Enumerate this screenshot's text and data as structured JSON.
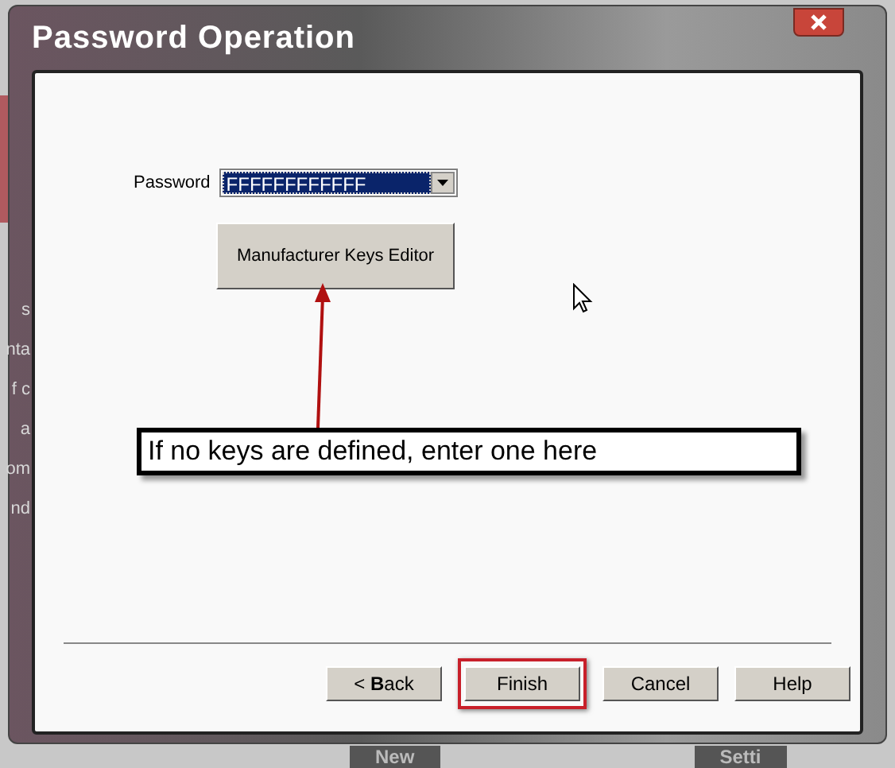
{
  "background": {
    "side_fragments": [
      "s",
      "nta",
      "f c",
      "a",
      "om",
      "nd"
    ],
    "bottom_buttons": [
      "New",
      "Setti"
    ]
  },
  "window": {
    "title": "Password Operation"
  },
  "password": {
    "label": "Password",
    "value": "FFFFFFFFFFFF"
  },
  "editor_button": "Manufacturer Keys Editor",
  "callout": "If no keys are defined, enter one here",
  "buttons": [
    {
      "label": "< **B**ack",
      "highlighted": false
    },
    {
      "label": "Finish",
      "highlighted": true
    },
    {
      "label": "Cancel",
      "highlighted": false
    },
    {
      "label": "Help",
      "highlighted": false
    }
  ]
}
